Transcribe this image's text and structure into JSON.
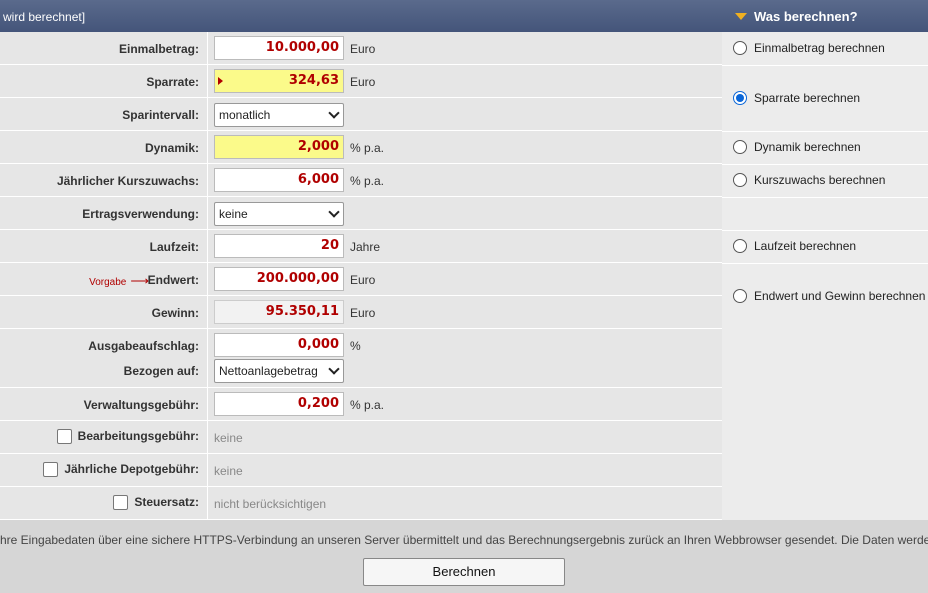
{
  "header": {
    "left_title": " wird berechnet]",
    "right_title": "Was berechnen?"
  },
  "form": {
    "einmalbetrag": {
      "label": "Einmalbetrag:",
      "value": "10.000,00",
      "unit": "Euro"
    },
    "sparrate": {
      "label": "Sparrate:",
      "value": "324,63",
      "unit": "Euro"
    },
    "sparintervall": {
      "label": "Sparintervall:",
      "value": "monatlich"
    },
    "dynamik": {
      "label": "Dynamik:",
      "value": "2,000",
      "unit": "% p.a."
    },
    "kurszuwachs": {
      "label": "Jährlicher Kurszuwachs:",
      "value": "6,000",
      "unit": "% p.a."
    },
    "ertragsverwendung": {
      "label": "Ertragsverwendung:",
      "value": "keine"
    },
    "laufzeit": {
      "label": "Laufzeit:",
      "value": "20",
      "unit": "Jahre"
    },
    "endwert": {
      "label": "Endwert:",
      "value": "200.000,00",
      "unit": "Euro",
      "vorgabe": "Vorgabe",
      "arrow": "⟶"
    },
    "gewinn": {
      "label": "Gewinn:",
      "value": "95.350,11",
      "unit": "Euro"
    },
    "ausgabeaufschlag": {
      "label": "Ausgabeaufschlag:",
      "value": "0,000",
      "unit": "%"
    },
    "bezogen_auf": {
      "label": "Bezogen auf:",
      "value": "Nettoanlagebetrag"
    },
    "verwaltungsgebuehr": {
      "label": "Verwaltungsgebühr:",
      "value": "0,200",
      "unit": "% p.a."
    },
    "bearbeitungsgebuehr": {
      "label": "Bearbeitungsgebühr:",
      "value": "keine"
    },
    "depotgebuehr": {
      "label": "Jährliche Depotgebühr:",
      "value": "keine"
    },
    "steuersatz": {
      "label": "Steuersatz:",
      "value": "nicht berücksichtigen"
    }
  },
  "side": {
    "options": [
      {
        "label": "Einmalbetrag berechnen",
        "checked": false
      },
      {
        "label": "Sparrate berechnen",
        "checked": true
      },
      {
        "label": "Dynamik berechnen",
        "checked": false
      },
      {
        "label": "Kurszuwachs berechnen",
        "checked": false
      },
      {
        "label": "Laufzeit berechnen",
        "checked": false
      },
      {
        "label": "Endwert und Gewinn berechnen",
        "checked": false
      }
    ]
  },
  "footer": {
    "note": "hre Eingabedaten über eine sichere HTTPS-Verbindung an unseren Server übermittelt und das Berechnungsergebnis zurück an Ihren Webbrowser gesendet. Die Daten werde",
    "button": "Berechnen"
  },
  "colors": {
    "header": "#4a5a7e",
    "value_red": "#b00000",
    "highlight_yellow": "#fbfa8a",
    "radio_blue": "#0a66d8"
  }
}
